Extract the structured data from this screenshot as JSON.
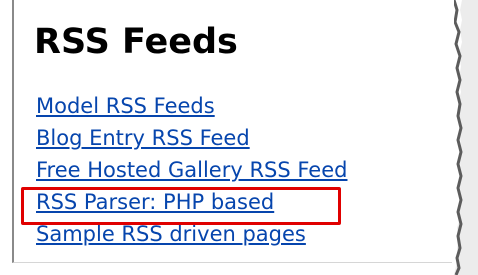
{
  "section": {
    "title": "RSS Feeds",
    "links": [
      "Model RSS Feeds",
      "Blog Entry RSS Feed",
      "Free Hosted Gallery RSS Feed",
      "RSS Parser: PHP based",
      "Sample RSS driven pages"
    ],
    "highlighted_link": "RSS Parser: PHP based"
  },
  "colors": {
    "link": "#0645ad",
    "highlight_border": "#e00000",
    "heading": "#000000"
  }
}
